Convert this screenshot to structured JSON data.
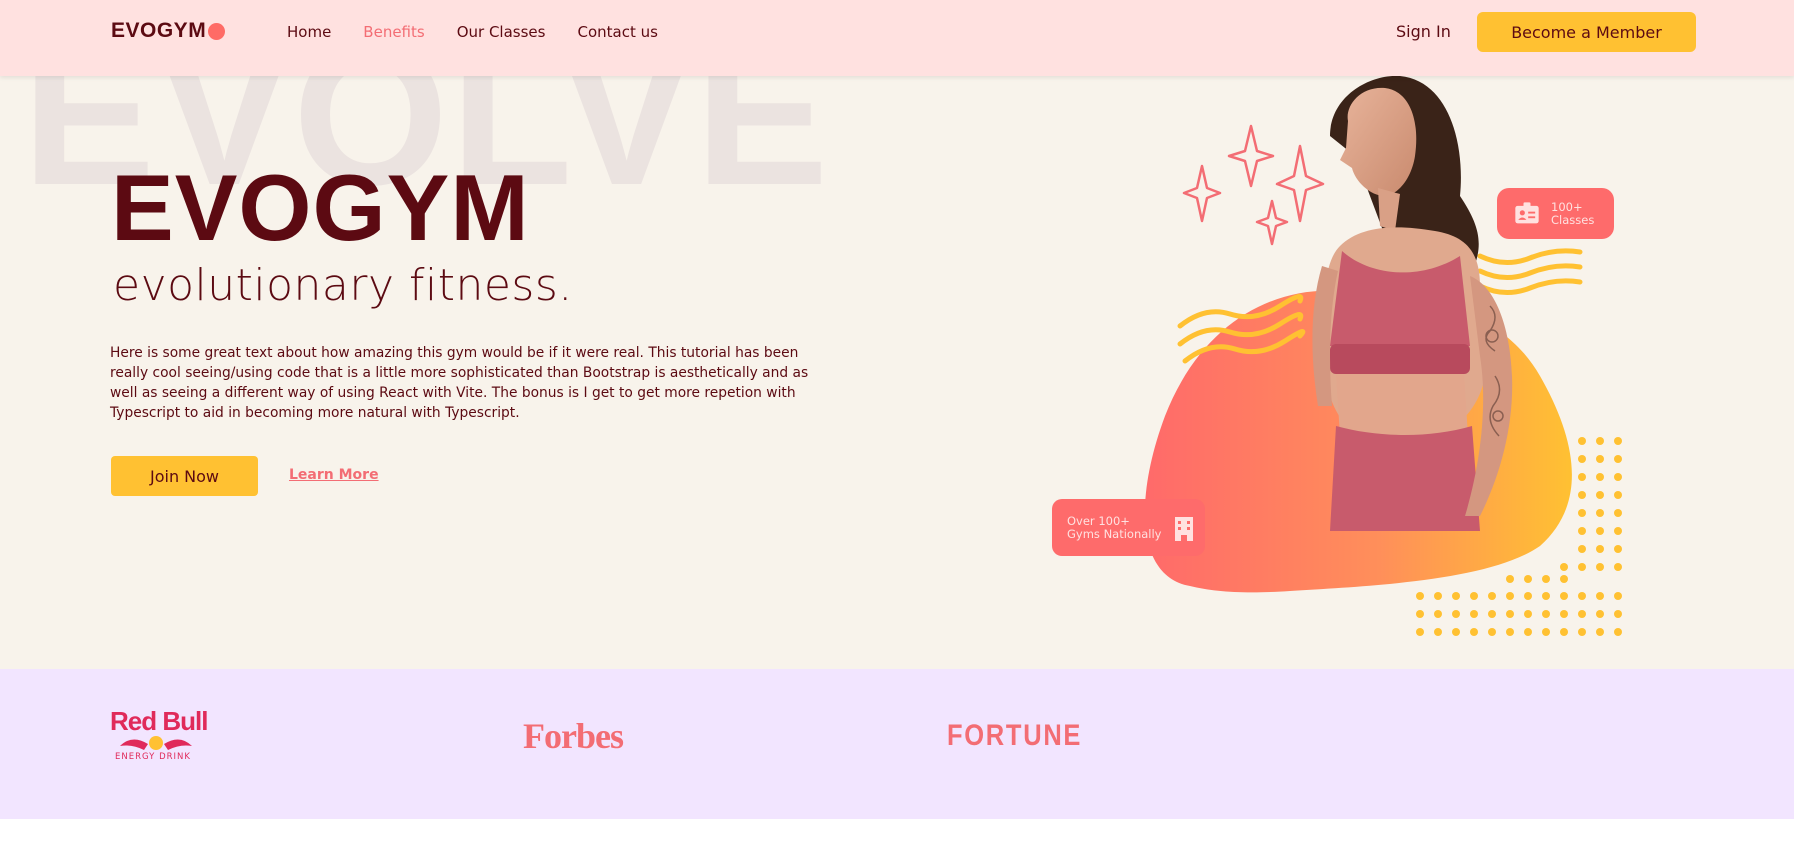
{
  "navbar": {
    "logo_text": "EVOGYM",
    "links": [
      "Home",
      "Benefits",
      "Our Classes",
      "Contact us"
    ],
    "active_link": "Benefits",
    "sign_in_label": "Sign In",
    "member_button_label": "Become a Member"
  },
  "hero": {
    "background_word": "EVOLVE",
    "title": "EVOGYM",
    "subtitle": "evolutionary fitness.",
    "description": "Here is some great text about how amazing this gym would be if it were real. This tutorial has been really cool seeing/using code that is a little more sophisticated than Bootstrap is aesthetically and as well as seeing a different way of using React with Vite. The bonus is I get to get more repetion with Typescript to aid in becoming more natural with Typescript.",
    "join_button_label": "Join Now",
    "learn_more_label": "Learn More",
    "badge_classes": {
      "line1": "100+",
      "line2": "Classes",
      "icon": "id-card-icon"
    },
    "badge_gyms": {
      "line1": "Over 100+",
      "line2": "Gyms Nationally",
      "icon": "building-icon"
    }
  },
  "sponsors": {
    "redbull": {
      "name": "Red Bull",
      "tagline": "ENERGY DRINK"
    },
    "forbes": {
      "name": "Forbes"
    },
    "fortune": {
      "name": "FORTUNE"
    }
  },
  "colors": {
    "primary_dark": "#5c0a12",
    "accent_pink": "#f36d74",
    "accent_yellow": "#ffc132",
    "nav_bg": "#ffe1e0",
    "hero_bg": "#f8f3eb",
    "sponsor_bg": "#f2e5ff"
  }
}
